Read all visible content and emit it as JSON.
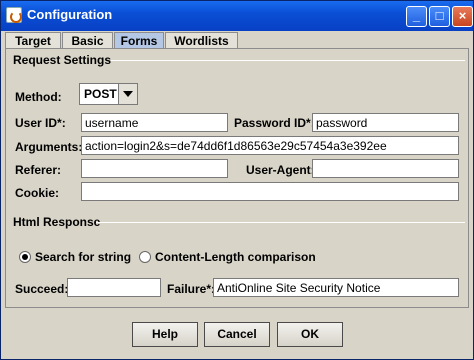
{
  "window": {
    "title": "Configuration",
    "controls": [
      "_",
      "□",
      "×"
    ]
  },
  "tabs": [
    {
      "label": "Target",
      "active": false
    },
    {
      "label": "Basic",
      "active": false
    },
    {
      "label": "Forms",
      "active": true
    },
    {
      "label": "Wordlists",
      "active": false
    }
  ],
  "request": {
    "group_label": "Request Settings",
    "method_label": "Method:",
    "method_value": "POST",
    "userid_label": "User ID*:",
    "userid_value": "username",
    "passwordid_label": "Password ID*:",
    "passwordid_value": "password",
    "arguments_label": "Arguments:",
    "arguments_value": "action=login2&s=de74dd6f1d86563e29c57454a3e392ee",
    "referer_label": "Referer:",
    "referer_value": "",
    "useragent_label": "User-Agent:",
    "useragent_value": "",
    "cookie_label": "Cookie:",
    "cookie_value": ""
  },
  "response": {
    "group_label": "Html Response",
    "radio_search_label": "Search for string",
    "radio_length_label": "Content-Length comparison",
    "selected": "search",
    "succeed_label": "Succeed:",
    "succeed_value": "",
    "failure_label": "Failure*:",
    "failure_value": "AntiOnline Site Security Notice"
  },
  "buttons": {
    "help": "Help",
    "cancel": "Cancel",
    "ok": "OK"
  }
}
